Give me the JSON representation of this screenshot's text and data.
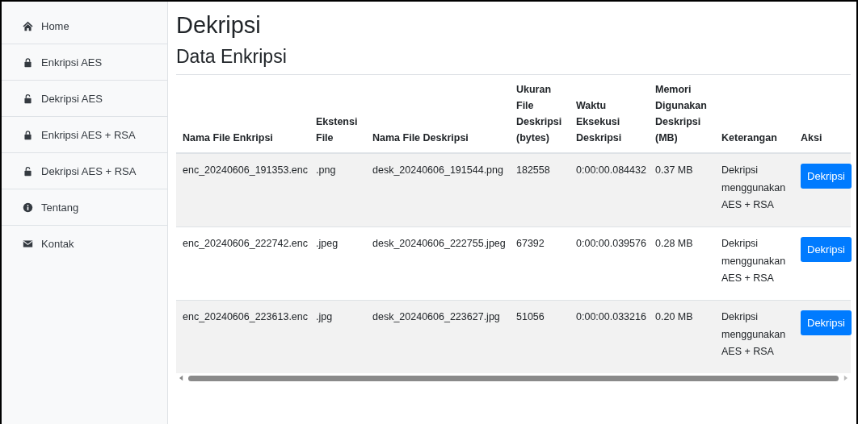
{
  "sidebar": {
    "items": [
      {
        "label": "Home",
        "kind": "home"
      },
      {
        "label": "Enkripsi AES",
        "kind": "lock"
      },
      {
        "label": "Dekripsi AES",
        "kind": "unlock"
      },
      {
        "label": "Enkripsi AES + RSA",
        "kind": "lock"
      },
      {
        "label": "Dekripsi AES + RSA",
        "kind": "unlock"
      },
      {
        "label": "Tentang",
        "kind": "info"
      },
      {
        "label": "Kontak",
        "kind": "mail"
      }
    ]
  },
  "page_title": "Dekripsi",
  "section_title": "Data Enkripsi",
  "table": {
    "columns": [
      "Nama File Enkripsi",
      "Ekstensi File",
      "Nama File Deskripsi",
      "Ukuran File Deskripsi (bytes)",
      "Waktu Eksekusi Deskripsi",
      "Memori Digunakan Deskripsi (MB)",
      "Keterangan",
      "Aksi"
    ],
    "rows": [
      {
        "cells": [
          "enc_20240606_191353.enc",
          ".png",
          "desk_20240606_191544.png",
          "182558",
          "0:00:00.084432",
          "0.37 MB",
          "Dekripsi menggunakan AES + RSA"
        ],
        "action": "Dekripsi"
      },
      {
        "cells": [
          "enc_20240606_222742.enc",
          ".jpeg",
          "desk_20240606_222755.jpeg",
          "67392",
          "0:00:00.039576",
          "0.28 MB",
          "Dekripsi menggunakan AES + RSA"
        ],
        "action": "Dekripsi"
      },
      {
        "cells": [
          "enc_20240606_223613.enc",
          ".jpg",
          "desk_20240606_223627.jpg",
          "51056",
          "0:00:00.033216",
          "0.20 MB",
          "Dekripsi menggunakan AES + RSA"
        ],
        "action": "Dekripsi"
      }
    ]
  }
}
